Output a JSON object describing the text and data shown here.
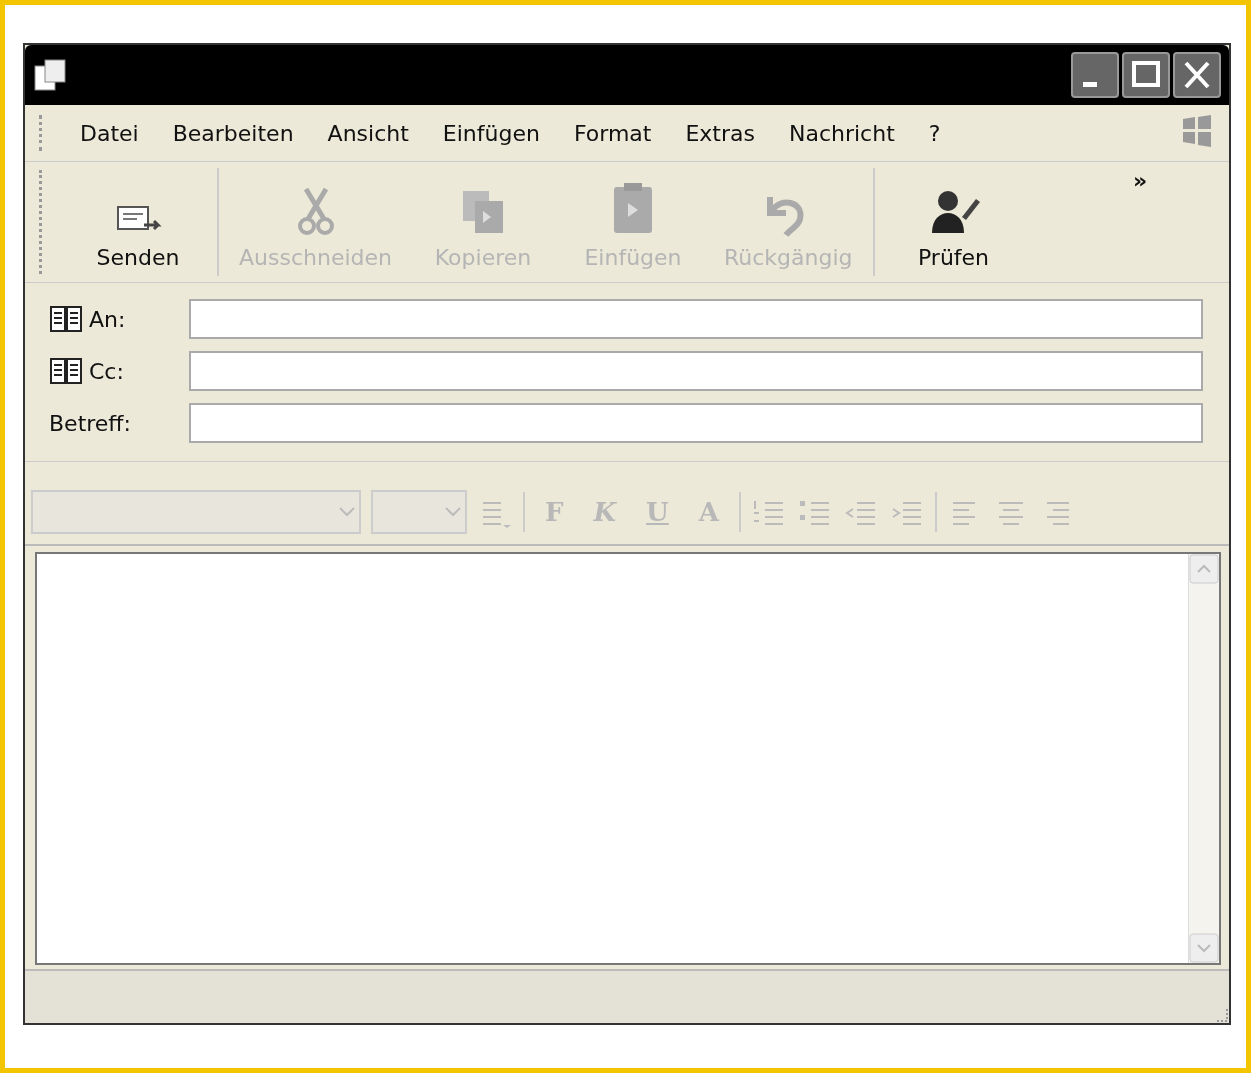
{
  "menu": [
    {
      "label": "Datei"
    },
    {
      "label": "Bearbeiten"
    },
    {
      "label": "Ansicht"
    },
    {
      "label": "Einfügen"
    },
    {
      "label": "Format"
    },
    {
      "label": "Extras"
    },
    {
      "label": "Nachricht"
    },
    {
      "label": "?"
    }
  ],
  "toolbar": {
    "buttons": [
      {
        "label": "Senden",
        "kind": "send",
        "disabled": false
      },
      {
        "label": "Ausschneiden",
        "kind": "cut",
        "disabled": true
      },
      {
        "label": "Kopieren",
        "kind": "copy",
        "disabled": true
      },
      {
        "label": "Einfügen",
        "kind": "paste",
        "disabled": true
      },
      {
        "label": "Rückgängig",
        "kind": "undo",
        "disabled": true
      },
      {
        "label": "Prüfen",
        "kind": "check",
        "disabled": false
      }
    ],
    "overflow": "»"
  },
  "fields": [
    {
      "label": "An:",
      "kind": "address"
    },
    {
      "label": "Cc:",
      "kind": "address"
    },
    {
      "label": "Betreff:",
      "kind": "subject"
    }
  ],
  "format_bar": {
    "disabled": true,
    "buttons": [
      {
        "label": "F",
        "kind": "bold"
      },
      {
        "label": "K",
        "kind": "italic"
      },
      {
        "label": "U",
        "kind": "underline"
      },
      {
        "label": "A",
        "kind": "color"
      }
    ]
  }
}
